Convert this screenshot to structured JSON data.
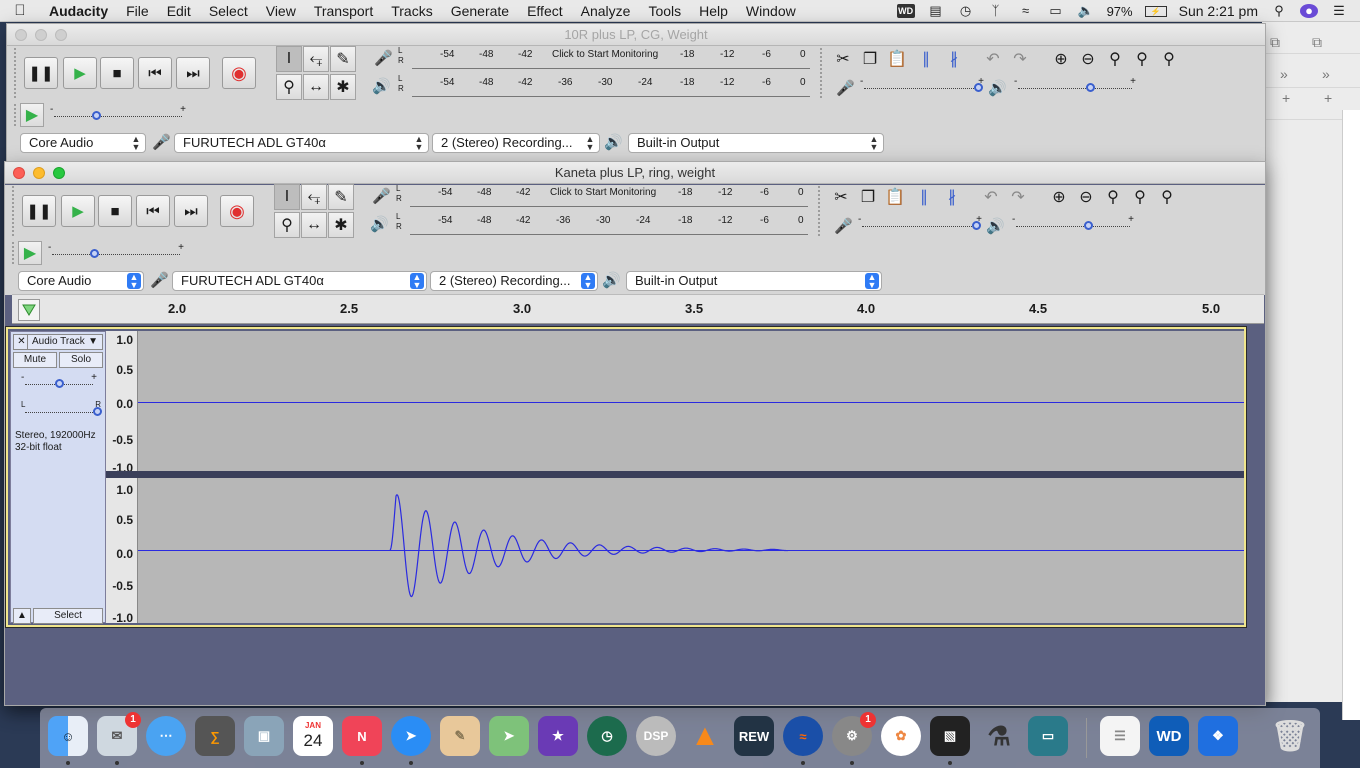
{
  "menubar": {
    "app_name": "Audacity",
    "items": [
      "File",
      "Edit",
      "Select",
      "View",
      "Transport",
      "Tracks",
      "Generate",
      "Effect",
      "Analyze",
      "Tools",
      "Help",
      "Window"
    ],
    "battery": "97%",
    "clock": "Sun 2:21 pm",
    "wd_badge": "WD"
  },
  "window_back": {
    "title": "10R plus LP, CG, Weight",
    "meter_click": "Click to Start Monitoring",
    "host": "Core Audio",
    "input_device": "FURUTECH ADL GT40α",
    "channels": "2 (Stereo) Recording...",
    "output_device": "Built-in Output"
  },
  "window_front": {
    "title": "Kaneta plus LP, ring, weight",
    "meter_click": "Click to Start Monitoring",
    "host": "Core Audio",
    "input_device": "FURUTECH ADL GT40α",
    "channels": "2 (Stereo) Recording...",
    "output_device": "Built-in Output"
  },
  "meter": {
    "lr_l": "L",
    "lr_r": "R",
    "record_ticks": [
      "-54",
      "-48",
      "-42",
      "-18",
      "-12",
      "-6",
      "0"
    ],
    "play_ticks": [
      "-54",
      "-48",
      "-42",
      "-36",
      "-30",
      "-24",
      "-18",
      "-12",
      "-6",
      "0"
    ],
    "plus": "+",
    "minus": "-"
  },
  "timeline": {
    "ticks": [
      "2.0",
      "2.5",
      "3.0",
      "3.5",
      "4.0",
      "4.5",
      "5.0"
    ]
  },
  "track": {
    "name": "Audio Track",
    "mute_label": "Mute",
    "solo_label": "Solo",
    "pan_left": "L",
    "pan_right": "R",
    "info_line1": "Stereo, 192000Hz",
    "info_line2": "32-bit float",
    "select_label": "Select",
    "close_glyph": "✕",
    "vruler_top": [
      "1.0",
      "0.5",
      "0.0",
      "-0.5",
      "-1.0"
    ],
    "vruler_bottom": [
      "1.0",
      "0.5",
      "0.0",
      "-0.5",
      "-1.0"
    ]
  },
  "dock": {
    "calendar_month": "JAN",
    "calendar_day": "24",
    "rew_label": "REW",
    "wd_label": "WD",
    "dsp_label": "DSP",
    "badge_mail": "1",
    "badge_prefs": "1"
  },
  "colors": {
    "waveform": "#2a2ae0",
    "record_button": "#e03030",
    "track_panel": "#d4dcf2"
  }
}
